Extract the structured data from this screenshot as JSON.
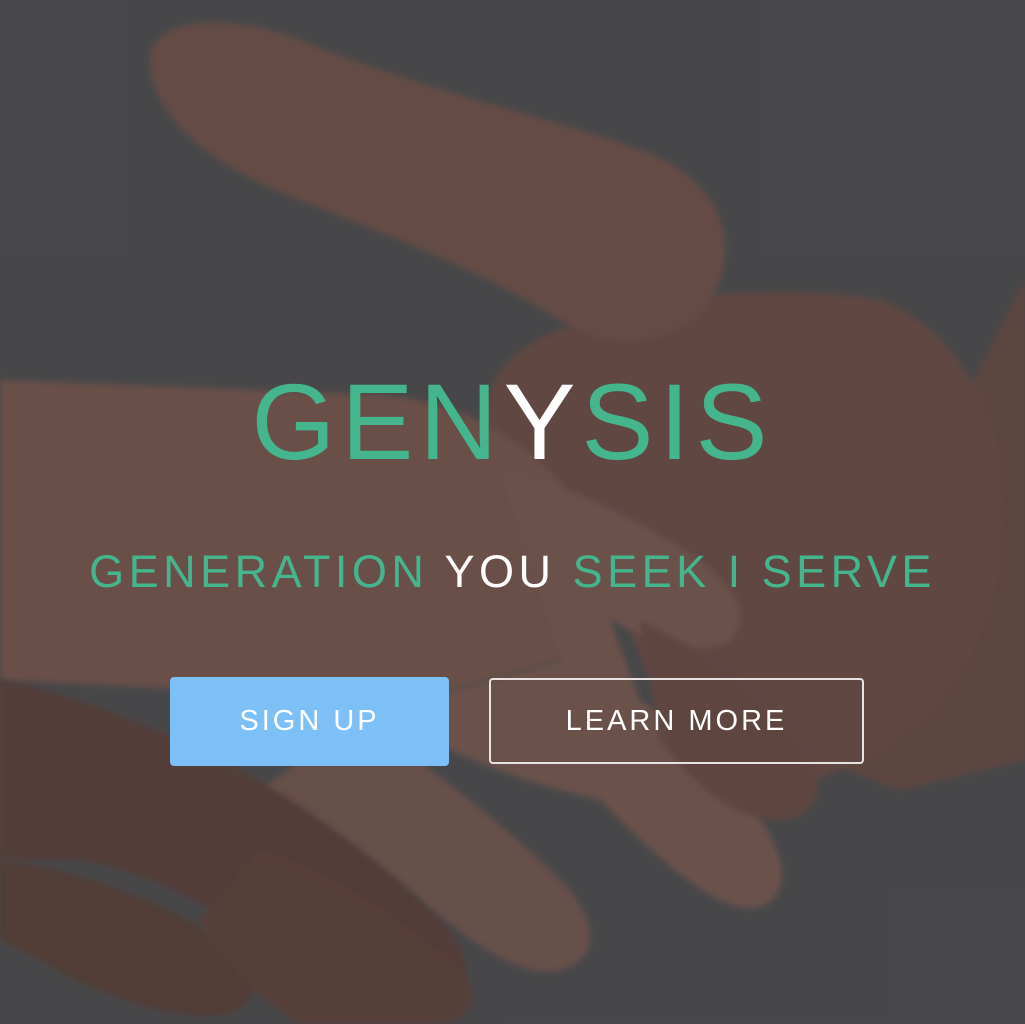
{
  "hero": {
    "brand_parts": [
      "GEN",
      "Y",
      "SIS"
    ],
    "tagline_parts": [
      "GENERATION",
      "YOU",
      "SEEK I SERVE"
    ],
    "signup_label": "SIGN UP",
    "learn_more_label": "LEARN MORE",
    "background_image": "handshake-photo"
  },
  "colors": {
    "accent": "#45b58d",
    "highlight": "#ffffff",
    "signup_button": "#7cc0f7",
    "overlay": "#4b4b4d"
  }
}
